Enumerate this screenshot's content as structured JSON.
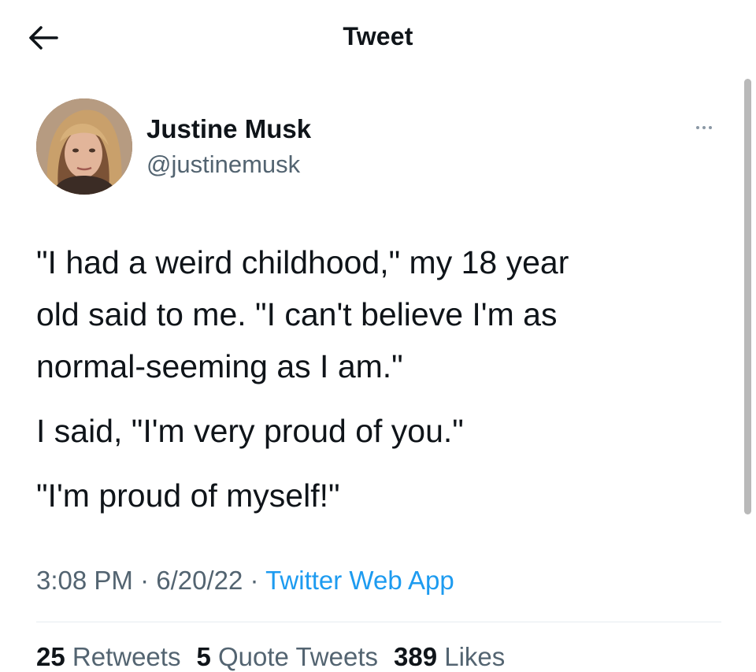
{
  "header": {
    "title": "Tweet",
    "back_icon": "arrow-left-icon"
  },
  "author": {
    "display_name": "Justine Musk",
    "handle": "@justinemusk",
    "more_icon": "more-horizontal-icon"
  },
  "tweet": {
    "lines": [
      "\"I had a weird childhood,\" my 18 year",
      "old said to me. \"I can't believe I'm as",
      "normal-seeming as I am.\"",
      "I said, \"I'm very proud of you.\"",
      "\"I'm proud of myself!\""
    ]
  },
  "meta": {
    "time": "3:08 PM",
    "separator": " · ",
    "date": "6/20/22",
    "source": "Twitter Web App"
  },
  "stats": {
    "retweets_count": "25",
    "retweets_label": "Retweets",
    "quotes_count": "5",
    "quotes_label": "Quote Tweets",
    "likes_count": "389",
    "likes_label": "Likes"
  },
  "colors": {
    "text_primary": "#0f1419",
    "text_secondary": "#536471",
    "link": "#1d9bf0",
    "divider": "#e6ecf0"
  }
}
